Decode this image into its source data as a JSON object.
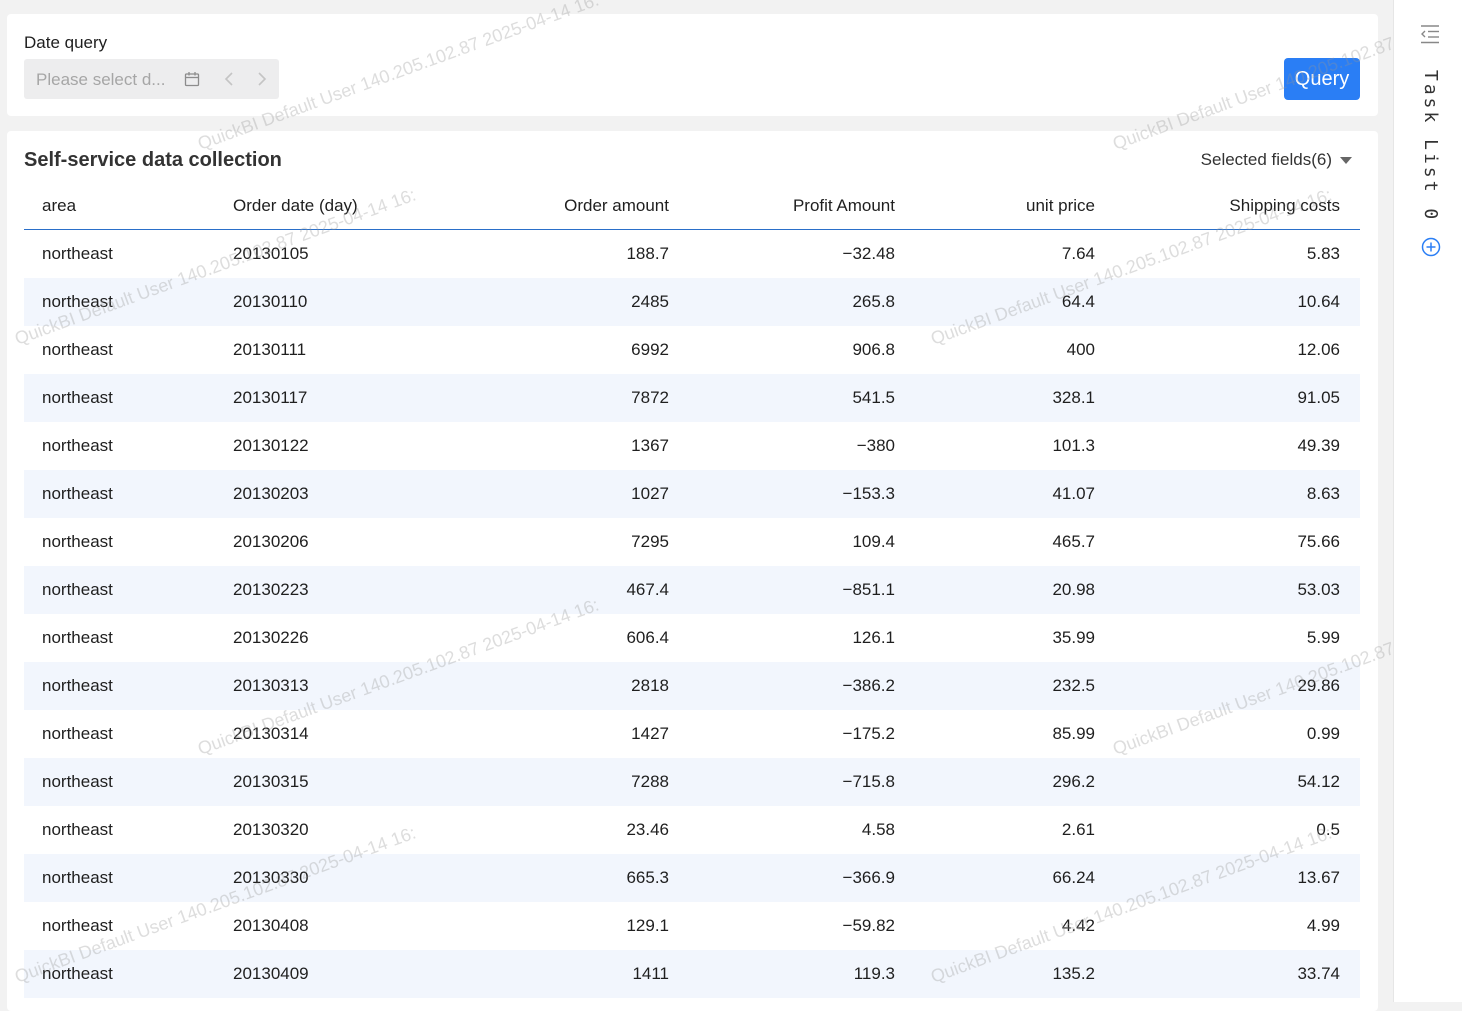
{
  "filter": {
    "label": "Date query",
    "date_placeholder": "Please select d...",
    "query_label": "Query"
  },
  "table": {
    "title": "Self-service data collection",
    "selected_fields": "Selected fields(6)",
    "columns": [
      "area",
      "Order date (day)",
      "Order amount",
      "Profit Amount",
      "unit price",
      "Shipping costs"
    ],
    "rows": [
      [
        "northeast",
        "20130105",
        "188.7",
        "−32.48",
        "7.64",
        "5.83"
      ],
      [
        "northeast",
        "20130110",
        "2485",
        "265.8",
        "64.4",
        "10.64"
      ],
      [
        "northeast",
        "20130111",
        "6992",
        "906.8",
        "400",
        "12.06"
      ],
      [
        "northeast",
        "20130117",
        "7872",
        "541.5",
        "328.1",
        "91.05"
      ],
      [
        "northeast",
        "20130122",
        "1367",
        "−380",
        "101.3",
        "49.39"
      ],
      [
        "northeast",
        "20130203",
        "1027",
        "−153.3",
        "41.07",
        "8.63"
      ],
      [
        "northeast",
        "20130206",
        "7295",
        "109.4",
        "465.7",
        "75.66"
      ],
      [
        "northeast",
        "20130223",
        "467.4",
        "−851.1",
        "20.98",
        "53.03"
      ],
      [
        "northeast",
        "20130226",
        "606.4",
        "126.1",
        "35.99",
        "5.99"
      ],
      [
        "northeast",
        "20130313",
        "2818",
        "−386.2",
        "232.5",
        "29.86"
      ],
      [
        "northeast",
        "20130314",
        "1427",
        "−175.2",
        "85.99",
        "0.99"
      ],
      [
        "northeast",
        "20130315",
        "7288",
        "−715.8",
        "296.2",
        "54.12"
      ],
      [
        "northeast",
        "20130320",
        "23.46",
        "4.58",
        "2.61",
        "0.5"
      ],
      [
        "northeast",
        "20130330",
        "665.3",
        "−366.9",
        "66.24",
        "13.67"
      ],
      [
        "northeast",
        "20130408",
        "129.1",
        "−59.82",
        "4.42",
        "4.99"
      ],
      [
        "northeast",
        "20130409",
        "1411",
        "119.3",
        "135.2",
        "33.74"
      ]
    ]
  },
  "sidebar": {
    "title": "Task List 0"
  },
  "watermark": {
    "text": "QuickBI Default User 140.205.102.87 2025-04-14 16:"
  },
  "colors": {
    "accent": "#2a7ef5",
    "header_line": "#2a6fc9",
    "stripe": "#f2f6fd"
  }
}
